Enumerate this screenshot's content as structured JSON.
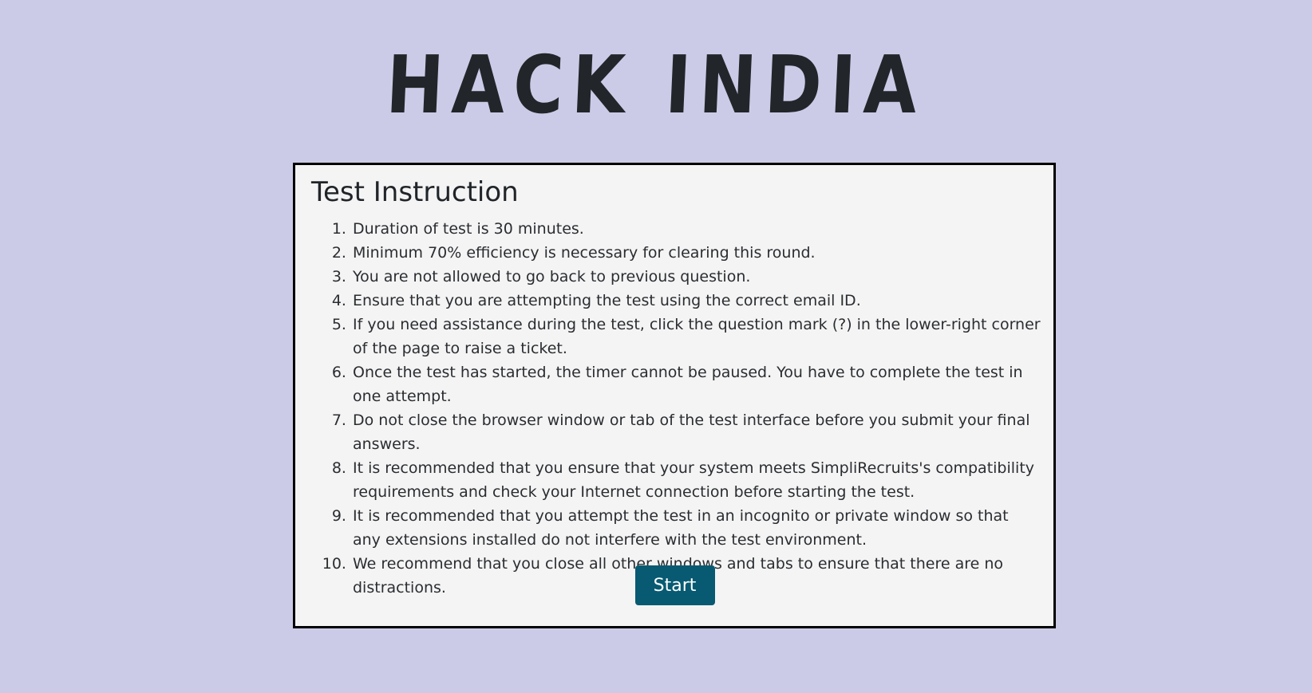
{
  "brand": {
    "title": "HACK INDIA"
  },
  "card": {
    "title": "Test Instruction",
    "instructions": [
      "Duration of test is 30 minutes.",
      "Minimum 70% efficiency is necessary for clearing this round.",
      "You are not allowed to go back to previous question.",
      "Ensure that you are attempting the test using the correct email ID.",
      "If you need assistance during the test, click the question mark (?) in the lower-right corner of the page to raise a ticket.",
      "Once the test has started, the timer cannot be paused. You have to complete the test in one attempt.",
      "Do not close the browser window or tab of the test interface before you submit your final answers.",
      "It is recommended that you ensure that your system meets SimpliRecruits's compatibility requirements and check your Internet connection before starting the test.",
      "It is recommended that you attempt the test in an incognito or private window so that any extensions installed do not interfere with the test environment.",
      "We recommend that you close all other windows and tabs to ensure that there are no distractions."
    ],
    "start_label": "Start"
  },
  "colors": {
    "background": "#cccbe7",
    "card_background": "#f4f4f4",
    "card_border": "#000000",
    "start_button": "#075a72",
    "title_text": "#22262a"
  }
}
